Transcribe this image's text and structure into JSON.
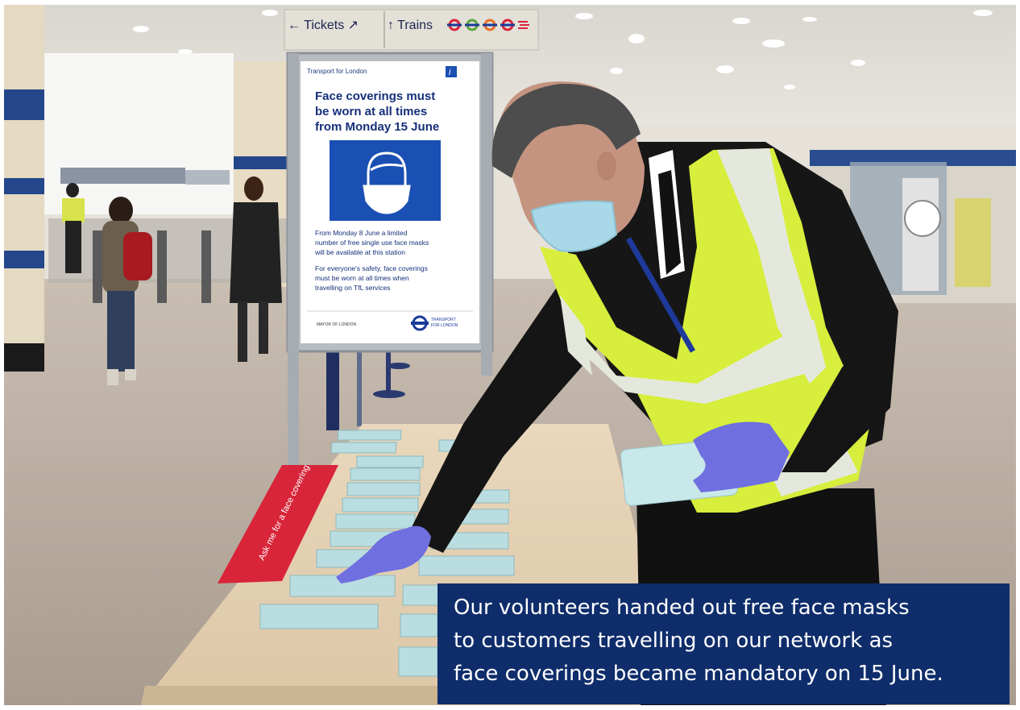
{
  "signage": {
    "tickets": "Tickets",
    "trains": "Trains"
  },
  "poster": {
    "org": "Transport for London",
    "info_badge": "i",
    "headline": [
      "Face coverings must",
      "be worn at all times",
      "from Monday 15 June"
    ],
    "body1": [
      "From Monday 8 June a limited",
      "number of free single use face masks",
      "will be available at this station"
    ],
    "body2": [
      "For everyone's safety, face coverings",
      "must be worn at all times when",
      "travelling on TfL services"
    ],
    "footer_left": "MAYOR OF LONDON",
    "footer_right": [
      "TRANSPORT",
      "FOR LONDON"
    ]
  },
  "table_banner": "Ask me for a face covering",
  "caption": [
    "Our volunteers handed out free face masks",
    "to customers travelling on our network as",
    "face coverings became mandatory on 15 June."
  ],
  "colors": {
    "caption_bg": "#0f2d6b",
    "tfl_blue": "#1a4fb4",
    "hi_vis": "#d7ee3c",
    "banner_red": "#d8253a"
  }
}
